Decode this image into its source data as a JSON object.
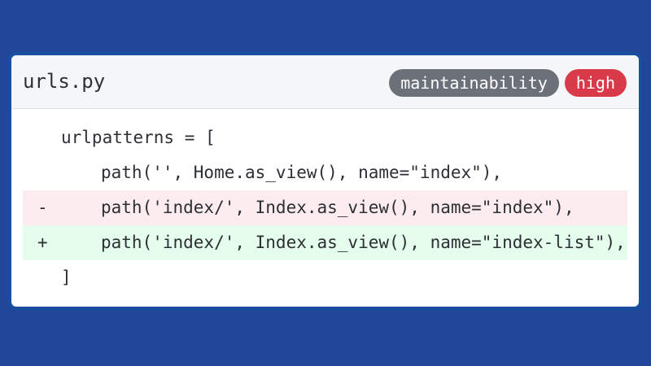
{
  "file": {
    "name": "urls.py"
  },
  "badges": {
    "category": "maintainability",
    "severity": "high"
  },
  "code": {
    "lines": [
      {
        "marker": "",
        "text": "urlpatterns = ["
      },
      {
        "marker": "",
        "text": "path('', Home.as_view(), name=\"index\"),"
      },
      {
        "marker": "-",
        "text": "path('index/', Index.as_view(), name=\"index\"),"
      },
      {
        "marker": "+",
        "text": "path('index/', Index.as_view(), name=\"index-list\"),"
      },
      {
        "marker": "",
        "text": "]"
      }
    ]
  },
  "colors": {
    "background": "#21479a",
    "category_badge": "#6b7079",
    "severity_badge": "#d83a4a",
    "removed_line_bg": "#fdecef",
    "added_line_bg": "#e5fdec"
  }
}
